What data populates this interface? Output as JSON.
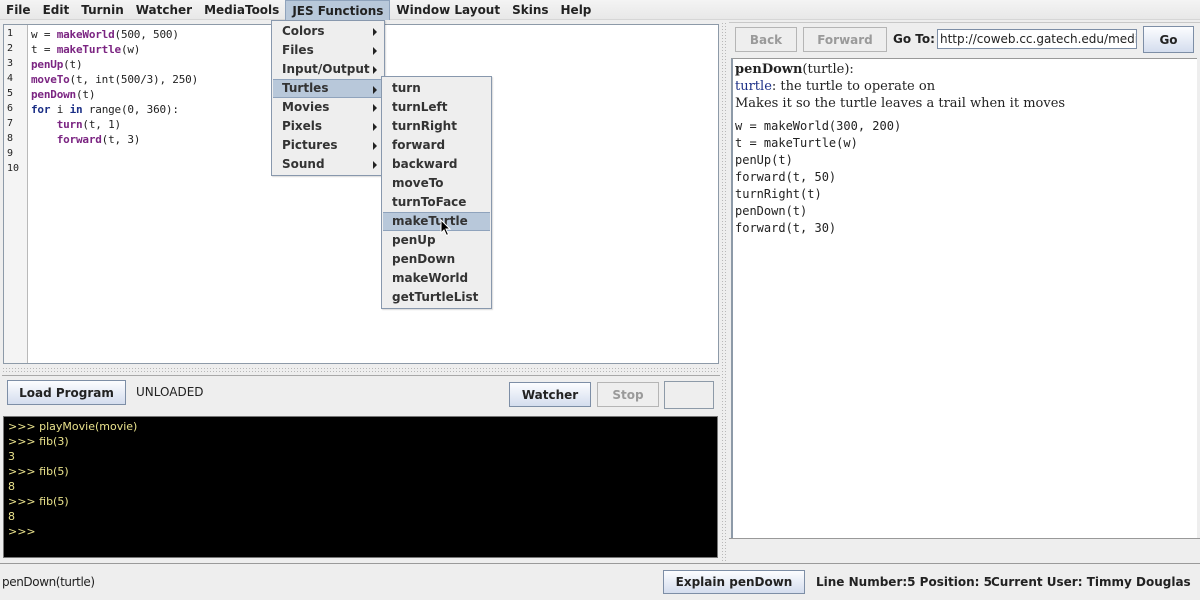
{
  "menubar": {
    "items": [
      "File",
      "Edit",
      "Turnin",
      "Watcher",
      "MediaTools",
      "JES Functions",
      "Window Layout",
      "Skins",
      "Help"
    ],
    "active": "JES Functions"
  },
  "editor": {
    "line_numbers": [
      "1",
      "2",
      "3",
      "4",
      "5",
      "6",
      "7",
      "8",
      "9",
      "10"
    ],
    "lines": [
      [
        {
          "t": "w = "
        },
        {
          "t": "makeWorld",
          "c": "fn"
        },
        {
          "t": "(500, 500)"
        }
      ],
      [
        {
          "t": "t = "
        },
        {
          "t": "makeTurtle",
          "c": "fn"
        },
        {
          "t": "(w)"
        }
      ],
      [
        {
          "t": "penUp",
          "c": "fn"
        },
        {
          "t": "(t)"
        }
      ],
      [
        {
          "t": "moveTo",
          "c": "fn"
        },
        {
          "t": "(t, int(500/3), 250)"
        }
      ],
      [
        {
          "t": "penDown",
          "c": "fn"
        },
        {
          "t": "(t)"
        }
      ],
      [
        {
          "t": "for",
          "c": "kw"
        },
        {
          "t": " i "
        },
        {
          "t": "in",
          "c": "kw"
        },
        {
          "t": " range(0, 360):"
        }
      ],
      [
        {
          "t": "    "
        },
        {
          "t": "turn",
          "c": "fn"
        },
        {
          "t": "(t, 1)"
        }
      ],
      [
        {
          "t": "    "
        },
        {
          "t": "forward",
          "c": "fn"
        },
        {
          "t": "(t, 3)"
        }
      ],
      [],
      []
    ]
  },
  "jes_menu": {
    "items": [
      "Colors",
      "Files",
      "Input/Output",
      "Turtles",
      "Movies",
      "Pixels",
      "Pictures",
      "Sound"
    ],
    "highlighted": "Turtles"
  },
  "turtles_submenu": {
    "items": [
      "turn",
      "turnLeft",
      "turnRight",
      "forward",
      "backward",
      "moveTo",
      "turnToFace",
      "makeTurtle",
      "penUp",
      "penDown",
      "makeWorld",
      "getTurtleList"
    ],
    "highlighted": "makeTurtle"
  },
  "controls": {
    "load_program": "Load Program",
    "load_status": "UNLOADED",
    "watcher": "Watcher",
    "stop": "Stop"
  },
  "console": {
    "lines": [
      ">>> playMovie(movie)",
      ">>> fib(3)",
      "3",
      ">>> fib(5)",
      "8",
      ">>> fib(5)",
      "8",
      ">>> "
    ]
  },
  "browser": {
    "back": "Back",
    "forward": "Forward",
    "goto_label": "Go To:",
    "url": "http://coweb.cc.gatech.edu/medi",
    "go": "Go"
  },
  "help": {
    "signature_name": "penDown",
    "signature_args": "(turtle):",
    "param_name": "turtle",
    "param_desc": ": the turtle to operate on",
    "description": "Makes it so the turtle leaves a trail when it moves",
    "example": [
      "w = makeWorld(300, 200)",
      "t = makeTurtle(w)",
      "penUp(t)",
      "forward(t, 50)",
      "turnRight(t)",
      "penDown(t)",
      "forward(t, 30)"
    ]
  },
  "statusbar": {
    "hint": "penDown(turtle)",
    "explain_button": "Explain penDown",
    "position": "Line Number:5 Position: 5",
    "user": "Current User: Timmy Douglas"
  },
  "colors": {
    "menu_highlight": "#b8c8da",
    "function_color": "#7b2582",
    "keyword_color": "#1b2f86",
    "console_text": "#e9e28c",
    "param_color": "#1b2f86"
  }
}
